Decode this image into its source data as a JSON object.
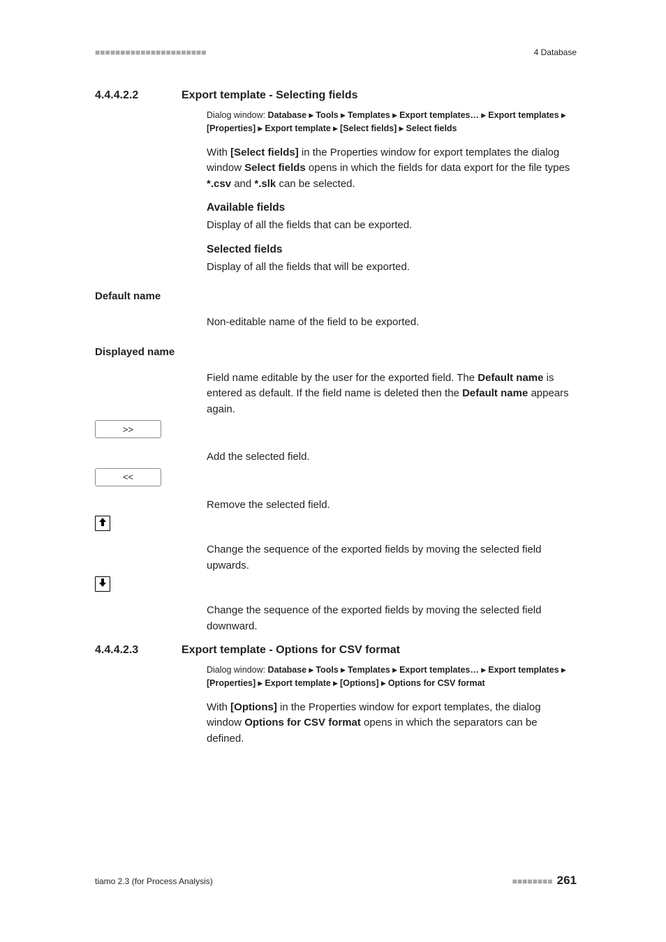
{
  "header": {
    "left": "■■■■■■■■■■■■■■■■■■■■■■",
    "right": "4 Database"
  },
  "sec1": {
    "num": "4.4.4.2.2",
    "title": "Export template - Selecting fields",
    "dw_prefix": "Dialog window: ",
    "dw_path": "Database ▸ Tools ▸ Templates ▸ Export templates… ▸ Export templates ▸ [Properties] ▸ Export template ▸ [Select fields] ▸ Select fields",
    "p1a": "With ",
    "p1b": "[Select fields]",
    "p1c": " in the Properties window for export templates the dialog window ",
    "p1d": "Select fields",
    "p1e": " opens in which the fields for data export for the file types ",
    "p1f": "*.csv",
    "p1g": " and ",
    "p1h": "*.slk",
    "p1i": " can be selected.",
    "avail_h": "Available fields",
    "avail_b": "Display of all the fields that can be exported.",
    "sel_h": "Selected fields",
    "sel_b": "Display of all the fields that will be exported.",
    "defname_h": "Default name",
    "defname_b": "Non-editable name of the field to be exported.",
    "dispname_h": "Displayed name",
    "dispname_b1": "Field name editable by the user for the exported field. The ",
    "dispname_b2": "Default name",
    "dispname_b3": " is entered as default. If the field name is deleted then the ",
    "dispname_b4": "Default name",
    "dispname_b5": " appears again.",
    "btn_add": ">>",
    "btn_add_d": "Add the selected field.",
    "btn_rem": "<<",
    "btn_rem_d": "Remove the selected field.",
    "up_d": "Change the sequence of the exported fields by moving the selected field upwards.",
    "dn_d": "Change the sequence of the exported fields by moving the selected field downward."
  },
  "sec2": {
    "num": "4.4.4.2.3",
    "title": "Export template - Options for CSV format",
    "dw_prefix": "Dialog window: ",
    "dw_path": "Database ▸ Tools ▸ Templates ▸ Export templates… ▸ Export templates ▸ [Properties] ▸ Export template ▸ [Options] ▸ Options for CSV format",
    "p1a": "With ",
    "p1b": "[Options]",
    "p1c": " in the Properties window for export templates, the dialog window ",
    "p1d": "Options for CSV format",
    "p1e": " opens in which the separators can be defined."
  },
  "footer": {
    "left": "tiamo 2.3 (for Process Analysis)",
    "dots": "■■■■■■■■",
    "page": "261"
  }
}
